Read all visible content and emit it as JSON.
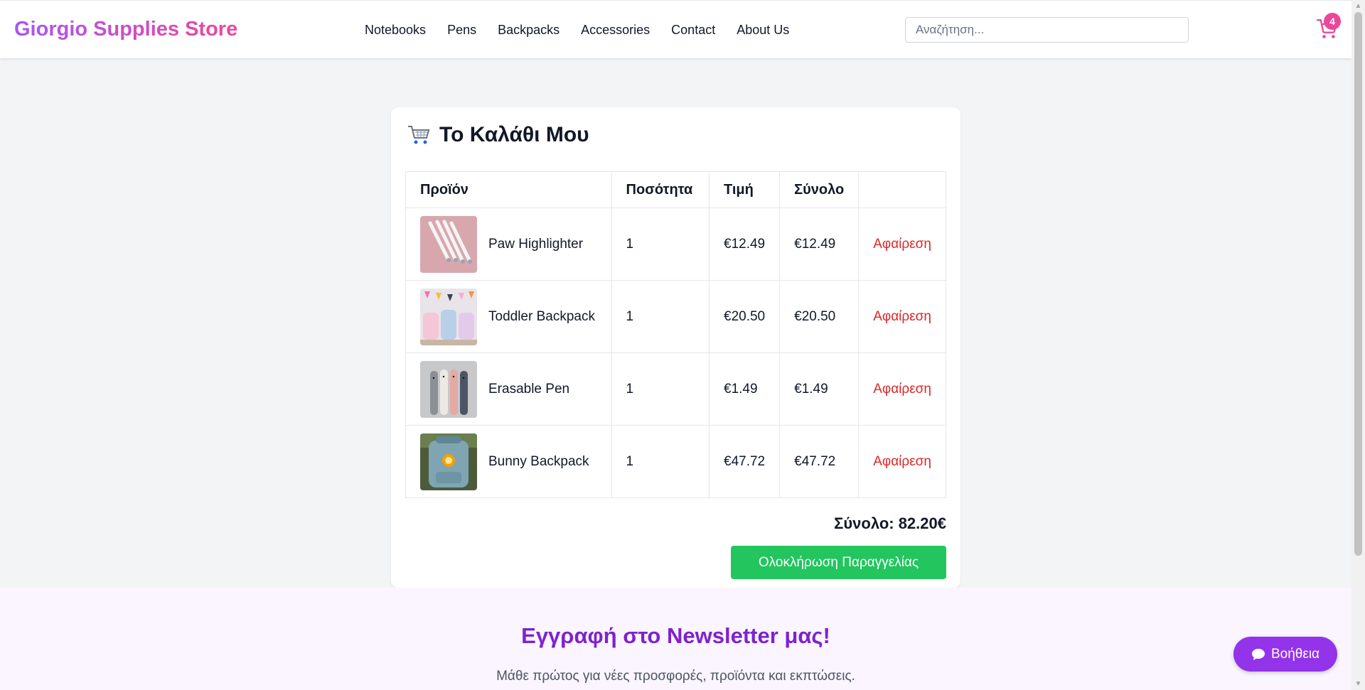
{
  "header": {
    "logo": "Giorgio Supplies Store",
    "nav": [
      "Notebooks",
      "Pens",
      "Backpacks",
      "Accessories",
      "Contact",
      "About Us"
    ],
    "search_placeholder": "Αναζήτηση...",
    "cart_count": "4"
  },
  "cart": {
    "title": "Το Καλάθι Μου",
    "columns": [
      "Προϊόν",
      "Ποσότητα",
      "Τιμή",
      "Σύνολο",
      ""
    ],
    "rows": [
      {
        "name": "Paw Highlighter",
        "qty": "1",
        "price": "€12.49",
        "total": "€12.49",
        "remove": "Αφαίρεση"
      },
      {
        "name": "Toddler Backpack",
        "qty": "1",
        "price": "€20.50",
        "total": "€20.50",
        "remove": "Αφαίρεση"
      },
      {
        "name": "Erasable Pen",
        "qty": "1",
        "price": "€1.49",
        "total": "€1.49",
        "remove": "Αφαίρεση"
      },
      {
        "name": "Bunny Backpack",
        "qty": "1",
        "price": "€47.72",
        "total": "€47.72",
        "remove": "Αφαίρεση"
      }
    ],
    "grand_total": "Σύνολο: 82.20€",
    "checkout_label": "Ολοκλήρωση Παραγγελίας"
  },
  "newsletter": {
    "title": "Εγγραφή στο Newsletter μας!",
    "subtitle": "Μάθε πρώτος για νέες προσφορές, προϊόντα και εκπτώσεις."
  },
  "help": {
    "label": "Βοήθεια"
  },
  "colors": {
    "brand_gradient_start": "#a855f7",
    "brand_gradient_end": "#ec4899",
    "remove": "#dc2626",
    "checkout": "#22c55e",
    "newsletter_title": "#7e22ce",
    "help_button": "#9333ea"
  }
}
